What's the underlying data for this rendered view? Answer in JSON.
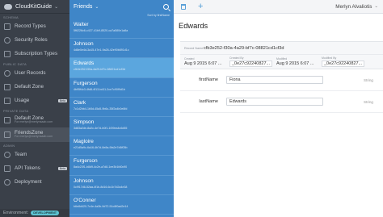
{
  "app": {
    "title": "CloudKitGuide"
  },
  "sidebar": {
    "sections": {
      "schema": "SCHEMA",
      "public_data": "PUBLIC DATA",
      "private_data": "PRIVATE DATA",
      "admin": "ADMIN"
    },
    "items": [
      {
        "label": "Record Types"
      },
      {
        "label": "Security Roles"
      },
      {
        "label": "Subscription Types"
      },
      {
        "label": "User Records"
      },
      {
        "label": "Default Zone"
      },
      {
        "label": "Usage",
        "badge": "Beta"
      },
      {
        "label": "Default Zone",
        "sub": "For merlyn@merlynsaab.com"
      },
      {
        "label": "FriendsZone",
        "sub": "For merlyn@merlynsaab.com"
      },
      {
        "label": "Team"
      },
      {
        "label": "API Tokens",
        "badge": "Beta"
      },
      {
        "label": "Deployment"
      }
    ],
    "environment_label": "Environment:",
    "environment_value": "DEVELOPMENT"
  },
  "list": {
    "title": "Friends",
    "sort": "Sort by firstName",
    "records": [
      {
        "name": "Walter",
        "id": "5f6226c6-c427-41b9-8520-ca7a580e1a8a"
      },
      {
        "name": "Johnson",
        "id": "4d8e0e4d-3a15-47e1-9a26-42e90b891d1c"
      },
      {
        "name": "Edwards",
        "id": "cfb3e252-f30a-4a29-bf7c-08821cd1cf3d"
      },
      {
        "name": "Furgerson",
        "id": "4b95f4c3-4fd8-4f13-bd11-2ce7c90f9d1b"
      },
      {
        "name": "Clark",
        "id": "7c1d2bb4-1b5d-45a5-9b6c-35f2a4b0e8fd"
      },
      {
        "name": "Simpson",
        "id": "3d83a2de-8a2c-4e7d-b0f1-1f09ea4c6d55"
      },
      {
        "name": "Magloire",
        "id": "e21d5a9c-6a16-4b7d-8e8a-9fa2e7d6f05b"
      },
      {
        "name": "Furgerson",
        "id": "8a4c23f1-b8d9-4c2e-a7d8-1ee3b1fd0c90"
      },
      {
        "name": "Johnson",
        "id": "0c9f17d6-52aa-4f1b-8d16-6c1b7d2a4e38"
      },
      {
        "name": "O'Conner",
        "id": "b6e8d420-7c4e-4a3b-9d72-51c8f0ad2e14"
      }
    ]
  },
  "detail": {
    "user": "Merlyn Alvaliotis",
    "title": "Edwards",
    "record_name_label": "Record Name",
    "record_name": "cfb3e252-f30a-4a29-bf7c-08821cd1cf3d",
    "meta": [
      {
        "label": "Created",
        "value": "Aug 9 2015 6:07 ..."
      },
      {
        "label": "Created By",
        "value": "_0e27c92240827..."
      },
      {
        "label": "Modified",
        "value": "Aug 9 2015 6:07 ..."
      },
      {
        "label": "Modified By",
        "value": "_0e27c92240827..."
      }
    ],
    "fields": [
      {
        "name": "firstName",
        "value": "Fiona",
        "type": "String"
      },
      {
        "name": "lastName",
        "value": "Edwards",
        "type": "String"
      }
    ]
  },
  "colors": {
    "sidebar": "#3a4049",
    "list": "#3f86c8",
    "selected": "#5ba6de",
    "accent": "#4f9bd6"
  },
  "icons": [
    "cloud-icon",
    "search-icon",
    "trash-icon",
    "plus-icon",
    "chevron-down-icon"
  ]
}
